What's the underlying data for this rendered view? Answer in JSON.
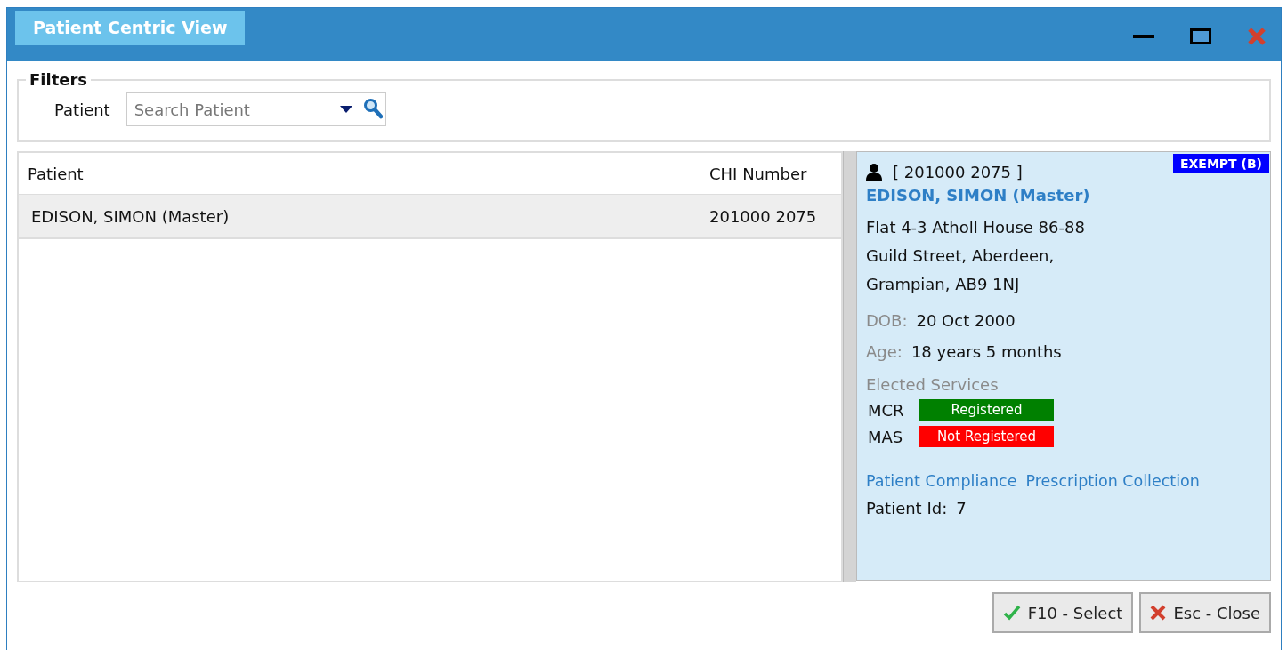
{
  "window": {
    "title": "Patient Centric View"
  },
  "filters": {
    "title": "Filters",
    "patient_label": "Patient",
    "search": {
      "placeholder": "Search Patient"
    }
  },
  "table": {
    "columns": [
      "Patient",
      "CHI Number"
    ],
    "rows": [
      {
        "cells": [
          "EDISON, SIMON (Master)",
          "201000 2075"
        ],
        "selected": true
      }
    ]
  },
  "details": {
    "chi": "[ 201000 2075 ]",
    "badge": "EXEMPT (B)",
    "name": "EDISON, SIMON (Master)",
    "address": [
      "Flat 4-3 Atholl House 86-88",
      "Guild Street, Aberdeen,",
      "Grampian, AB9 1NJ"
    ],
    "dob_label": "DOB:",
    "dob": "20 Oct 2000",
    "age_label": "Age:",
    "age": "18 years 5 months",
    "services_title": "Elected Services",
    "services": [
      {
        "code": "MCR",
        "status": "Registered",
        "color": "#008000"
      },
      {
        "code": "MAS",
        "status": "Not Registered",
        "color": "#ff0000"
      }
    ],
    "links": [
      "Patient Compliance",
      "Prescription Collection"
    ],
    "patient_id_label": "Patient Id:",
    "patient_id": "7"
  },
  "buttons": [
    {
      "kind": "select",
      "label": "F10 - Select"
    },
    {
      "kind": "close",
      "label": "Esc - Close"
    }
  ]
}
